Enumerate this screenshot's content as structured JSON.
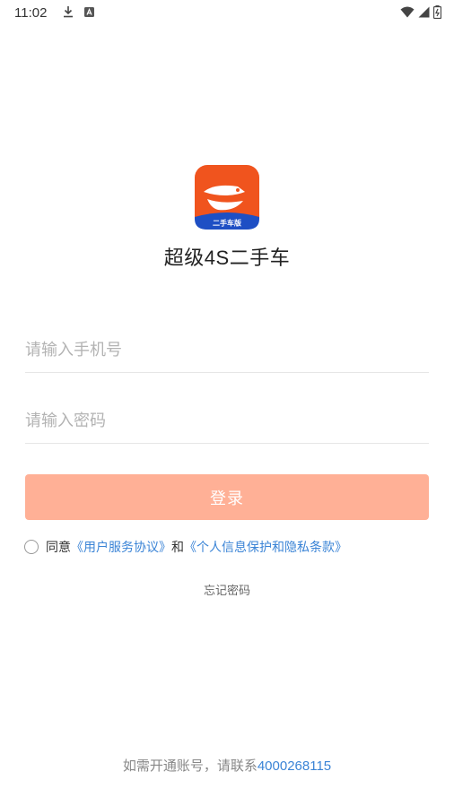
{
  "status_bar": {
    "time": "11:02",
    "icons_left": [
      "download-icon",
      "a-badge-icon"
    ],
    "icons_right": [
      "wifi-icon",
      "signal-icon",
      "battery-icon"
    ]
  },
  "app": {
    "name": "超级4S二手车",
    "logo_badge_text": "二手车版",
    "colors": {
      "logo_orange": "#f0541e",
      "logo_blue": "#1e4fc4",
      "accent_link": "#3b84d6",
      "button": "#ffb096"
    }
  },
  "form": {
    "phone_placeholder": "请输入手机号",
    "phone_value": "",
    "password_placeholder": "请输入密码",
    "password_value": "",
    "login_label": "登录"
  },
  "agreement": {
    "prefix": "同意",
    "terms_link": "《用户服务协议》",
    "and": "和",
    "privacy_link": "《个人信息保护和隐私条款》",
    "checked": false
  },
  "forgot_password": "忘记密码",
  "contact": {
    "text": "如需开通账号，请联系",
    "phone": "4000268115"
  }
}
